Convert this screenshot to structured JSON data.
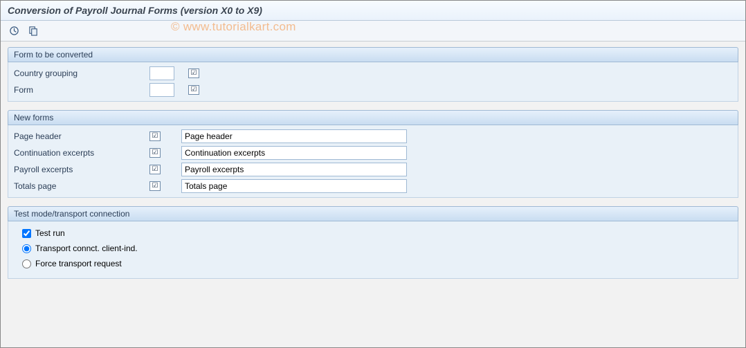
{
  "title": "Conversion of Payroll Journal Forms (version X0 to X9)",
  "watermark": "© www.tutorialkart.com",
  "toolbar": {
    "execute_name": "execute",
    "variant_name": "get-variant"
  },
  "group1": {
    "title": "Form to be converted",
    "country_label": "Country grouping",
    "country_value": "",
    "form_label": "Form",
    "form_value": ""
  },
  "group2": {
    "title": "New forms",
    "rows": [
      {
        "label": "Page header",
        "value": "Page header"
      },
      {
        "label": "Continuation excerpts",
        "value": "Continuation excerpts"
      },
      {
        "label": "Payroll excerpts",
        "value": "Payroll excerpts"
      },
      {
        "label": "Totals page",
        "value": "Totals page"
      }
    ]
  },
  "group3": {
    "title": "Test mode/transport connection",
    "testrun_label": "Test run",
    "testrun_checked": true,
    "opt1_label": "Transport connct. client-ind.",
    "opt2_label": "Force transport request",
    "selected": "opt1"
  }
}
